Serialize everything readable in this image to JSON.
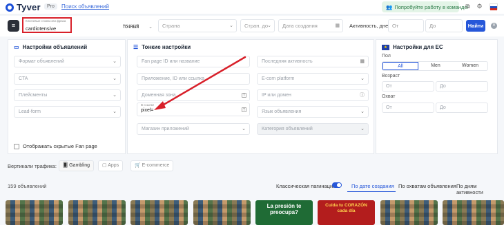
{
  "topbar": {
    "logo": "Tyver",
    "badge": "Pro",
    "ads_search_link": "Поиск объявлений",
    "promo": "Попробуйте работу в команде!",
    "flag_colors": [
      "#ffffff",
      "#1f4fbf",
      "#d52b1e"
    ]
  },
  "search": {
    "keyword_label": "Ключевые слова или фраза",
    "keyword_value": "cardiotensive",
    "search_type_label": "Тип поиска",
    "search_type_value": "точный",
    "country_placeholder": "Страна",
    "country_short_placeholder": "Стран. до",
    "created_placeholder": "Дата создания",
    "activity_label": "Активность, дней",
    "from_placeholder": "От",
    "to_placeholder": "До",
    "submit_label": "Найти"
  },
  "ad_settings": {
    "title": "Настройки объявлений",
    "fields": [
      "Формат объявлений",
      "CTA",
      "Плейсменты",
      "Lead-form"
    ]
  },
  "fine_settings": {
    "title": "Тонкие настройки",
    "left": [
      "Fan page ID или название",
      "Приложение, ID или ссылка",
      "Доменная зона"
    ],
    "link_label": "В ссылке",
    "link_value": "pixel=",
    "app_store": "Магазин приложений",
    "right": [
      "Последняя активность",
      "E-com platform",
      "IP или домен",
      "Язык объявления",
      "Категория объявлений"
    ]
  },
  "ec_settings": {
    "title": "Настройки для ЕС",
    "gender_label": "Пол",
    "genders": [
      "All",
      "Men",
      "Women"
    ],
    "age_label": "Возраст",
    "reach_label": "Охват",
    "from": "От",
    "to": "До"
  },
  "show_hidden": "Отображать скрытые Fan page",
  "verticals": {
    "label": "Вертикали трафика:",
    "items": [
      "Gambling",
      "Apps",
      "E-commerce"
    ]
  },
  "results": {
    "count": "159 объявлений",
    "pagination": "Классическая пагинация",
    "sorts": [
      "По дате создания",
      "По охватам объявления",
      "По дням активности"
    ]
  },
  "thumbnails": {
    "green": "La presión te preocupa?",
    "red_line1": "Cuida tu",
    "red_highlight": "CORAZÓN",
    "red_line2": "cada día"
  },
  "colors": {
    "accent": "#2657d9",
    "highlight_box": "#d8202a",
    "arrow": "#d8202a"
  }
}
